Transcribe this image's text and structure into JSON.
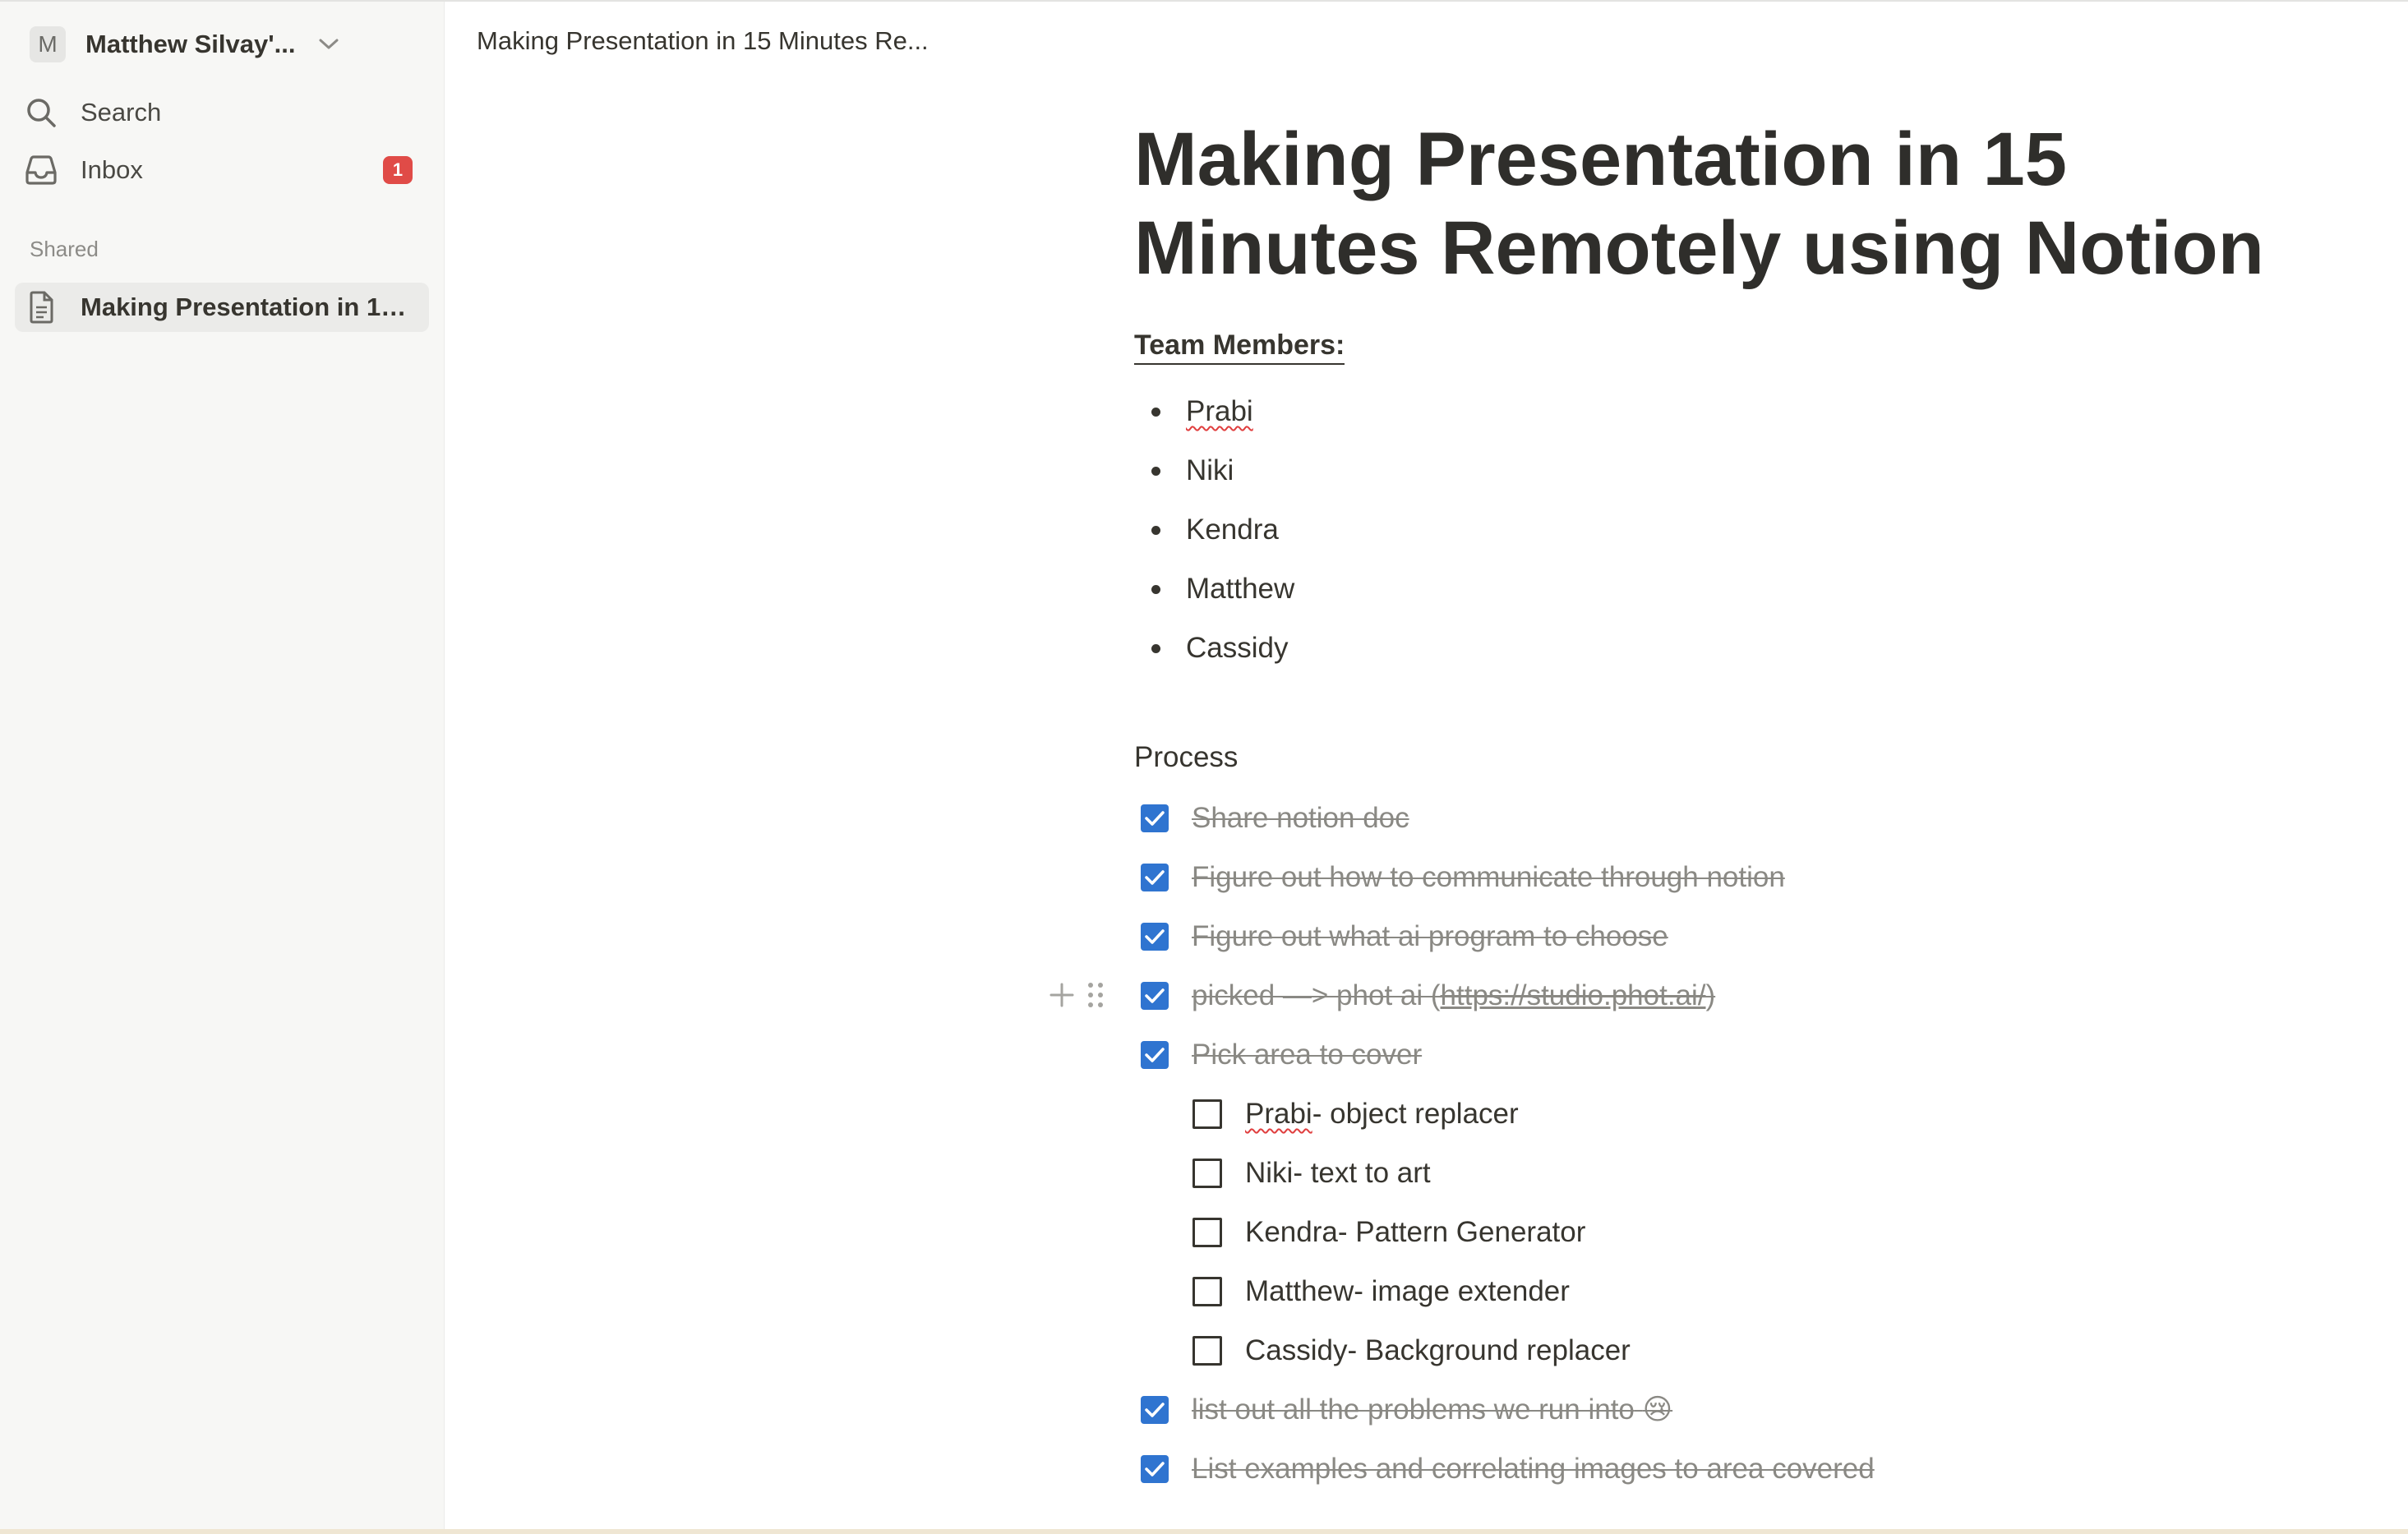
{
  "sidebar": {
    "workspace": {
      "initial": "M",
      "name": "Matthew Silvay'..."
    },
    "search_label": "Search",
    "inbox_label": "Inbox",
    "inbox_badge": "1",
    "section_label": "Shared",
    "page_item": "Making Presentation in 15 ..."
  },
  "topbar": {
    "breadcrumb": "Making Presentation in 15 Minutes Re..."
  },
  "page": {
    "title": "Making Presentation in 15 Minutes Remotely using Notion",
    "team_heading": "Team Members:",
    "members": [
      "Prabi",
      "Niki",
      "Kendra",
      "Matthew",
      "Cassidy"
    ],
    "process_heading": "Process",
    "todos": [
      {
        "text": "Share notion doc",
        "checked": true
      },
      {
        "text": "Figure out how to communicate through notion",
        "checked": true
      },
      {
        "text": "Figure out what ai program to choose",
        "checked": true
      },
      {
        "text_prefix": "picked —> phot ai (",
        "link": "https://studio.phot.ai/",
        "text_suffix": ")",
        "checked": true
      },
      {
        "text": "Pick area to cover",
        "checked": true
      },
      {
        "text_name": "Prabi",
        "text": "- object replacer",
        "checked": false
      },
      {
        "text": "Niki- text to art",
        "checked": false
      },
      {
        "text": "Kendra- Pattern Generator",
        "checked": false
      },
      {
        "text": "Matthew- image extender",
        "checked": false
      },
      {
        "text": "Cassidy- Background replacer",
        "checked": false
      },
      {
        "text": "list out all the problems we run into",
        "emoji": "😢",
        "checked": true
      },
      {
        "text": "List examples and correlating images to area covered",
        "checked": true
      }
    ]
  },
  "colors": {
    "checkbox_checked": "#2f74d0",
    "badge": "#e04b47",
    "sidebar_bg": "#f7f7f5"
  },
  "icons": [
    "chevron-down-icon",
    "search-icon",
    "inbox-icon",
    "page-icon",
    "plus-icon",
    "drag-handle-icon",
    "checkmark-icon"
  ]
}
